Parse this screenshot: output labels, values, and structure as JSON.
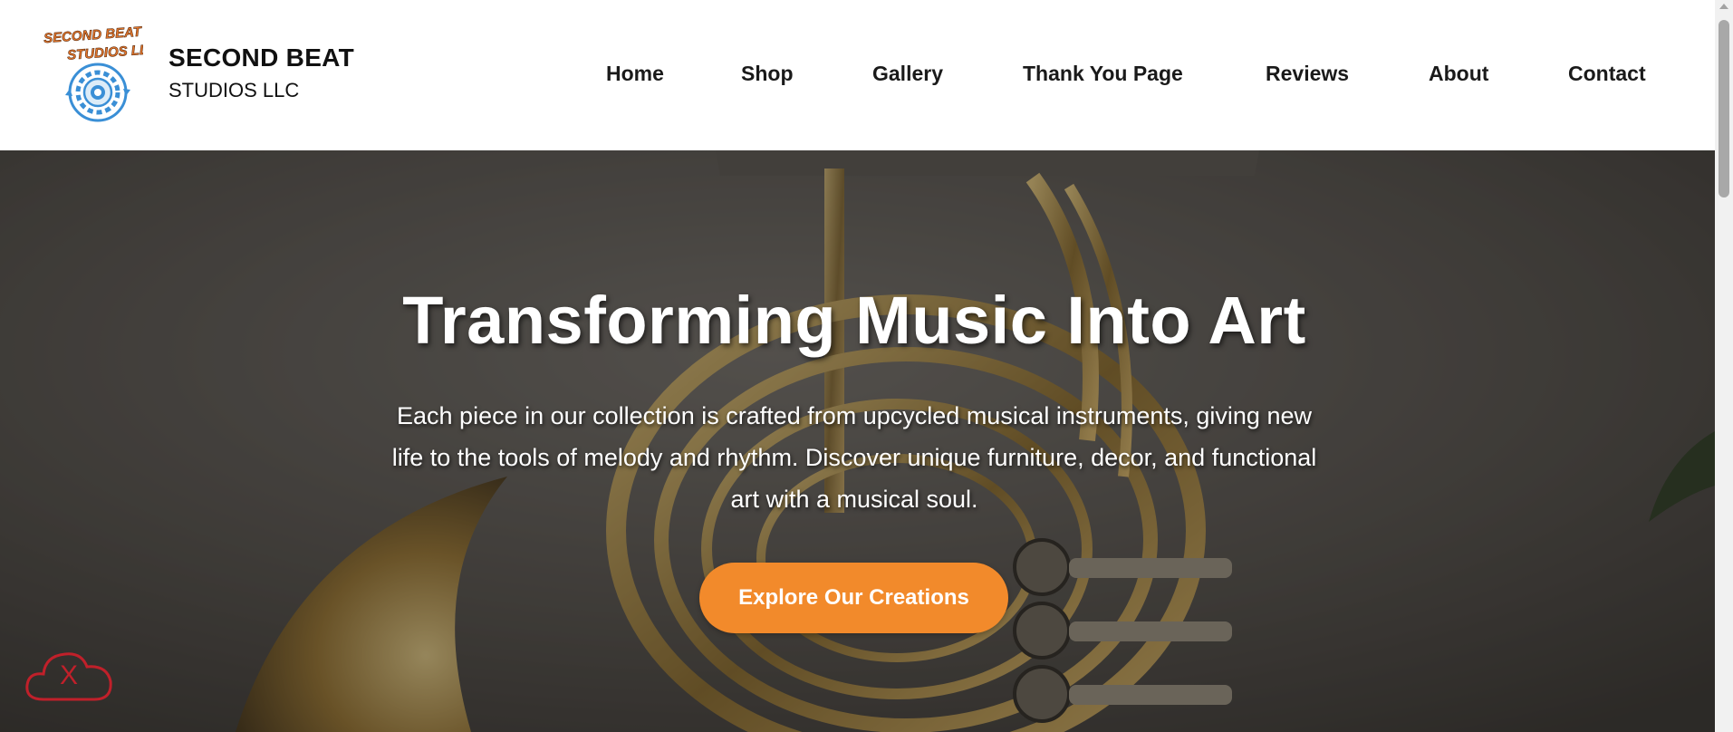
{
  "header": {
    "logo": {
      "text_line1": "SECOND BEAT",
      "text_line2": "STUDIOS LLC",
      "icon": "gear-recycle-icon"
    },
    "brand_name": "SECOND BEAT",
    "brand_sub": "STUDIOS LLC"
  },
  "nav": {
    "items": [
      {
        "label": "Home"
      },
      {
        "label": "Shop"
      },
      {
        "label": "Gallery"
      },
      {
        "label": "Thank You Page"
      },
      {
        "label": "Reviews"
      },
      {
        "label": "About"
      },
      {
        "label": "Contact"
      }
    ]
  },
  "hero": {
    "title": "Transforming Music Into Art",
    "text": "Each piece in our collection is crafted from upcycled musical instruments, giving new life to the tools of melody and rhythm. Discover unique furniture, decor, and functional art with a musical soul.",
    "cta_label": "Explore Our Creations",
    "background": "french-horn-photo"
  },
  "badge": {
    "icon": "cloud-icon",
    "mark": "X"
  },
  "colors": {
    "accent": "#f28a2b",
    "logo_blue": "#3a8fd6",
    "logo_orange": "#e8782c",
    "badge_red": "#c0202a"
  }
}
